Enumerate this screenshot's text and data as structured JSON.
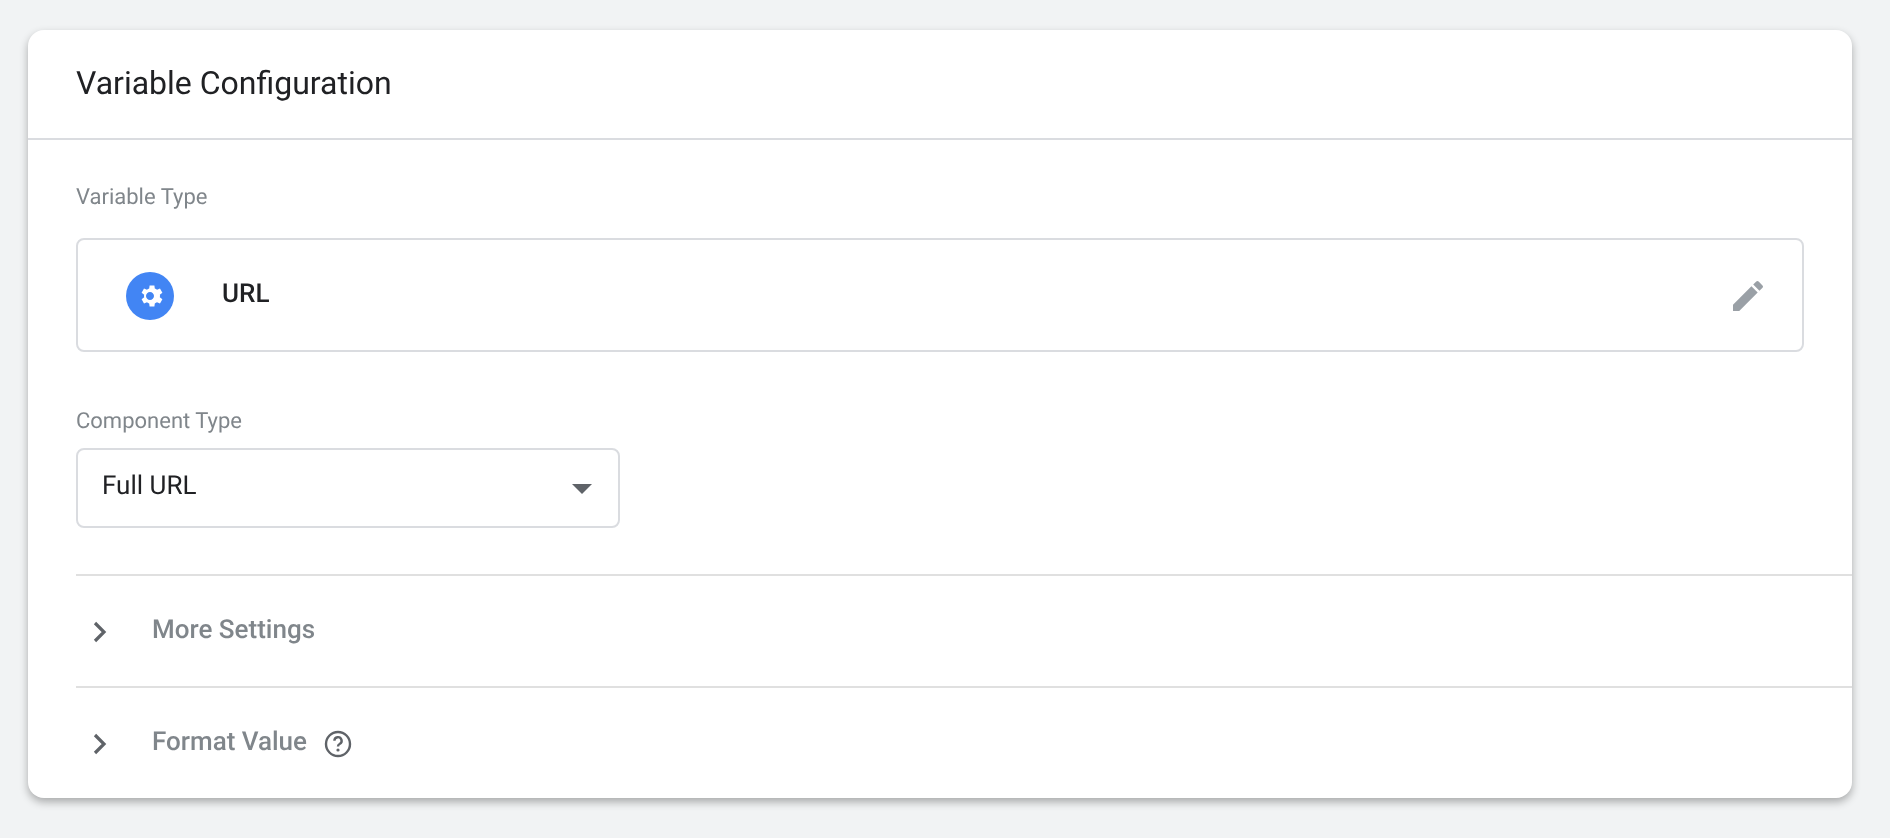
{
  "card": {
    "title": "Variable Configuration"
  },
  "variable_type": {
    "label": "Variable Type",
    "value": "URL"
  },
  "component_type": {
    "label": "Component Type",
    "value": "Full URL"
  },
  "sections": [
    {
      "label": "More Settings",
      "expanded": false,
      "help": false
    },
    {
      "label": "Format Value",
      "expanded": false,
      "help": true
    }
  ]
}
